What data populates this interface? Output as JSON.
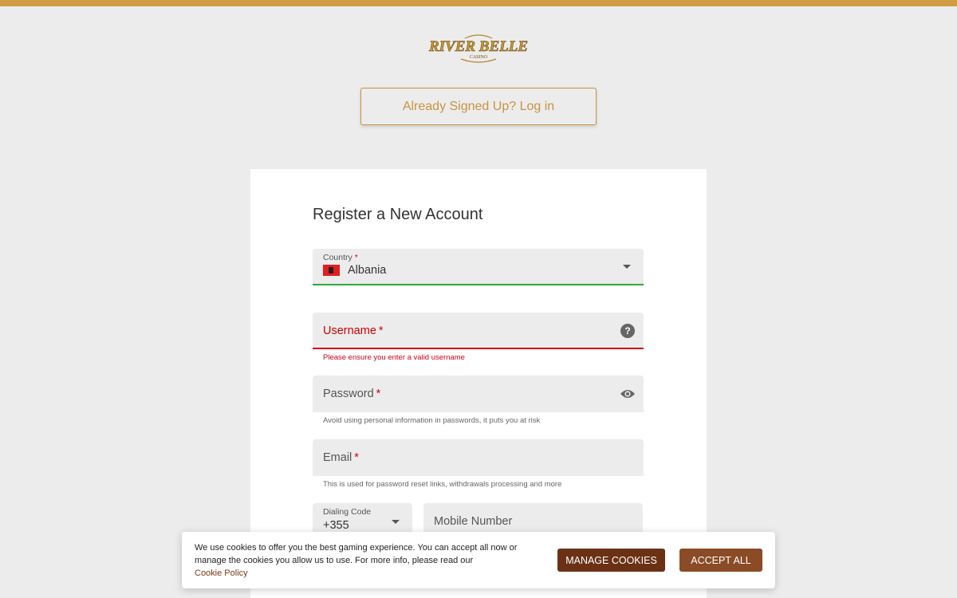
{
  "brand": {
    "logo_text": "RIVER BELLE",
    "logo_sub": "CASINO",
    "accent_color": "#d09d45"
  },
  "login_button": "Already Signed Up? Log in",
  "form": {
    "title": "Register a New Account",
    "country": {
      "label": "Country",
      "value": "Albania",
      "flag": "albania-flag-icon"
    },
    "username": {
      "label": "Username",
      "error": "Please ensure you enter a valid username"
    },
    "password": {
      "label": "Password",
      "helper": "Avoid using personal information in passwords, it puts you at risk"
    },
    "email": {
      "label": "Email",
      "helper": "This is used for password reset links, withdrawals processing and more"
    },
    "dialing_code": {
      "label": "Dialing Code",
      "value": "+355"
    },
    "mobile": {
      "label": "Mobile Number"
    },
    "required_mark": "*"
  },
  "cookie_banner": {
    "text": "We use cookies to offer you the best gaming experience. You can accept all now or manage the cookies you allow us to use. For more info, please read our",
    "link": "Cookie Policy",
    "manage_label": "MANAGE COOKIES",
    "accept_label": "ACCEPT ALL"
  }
}
